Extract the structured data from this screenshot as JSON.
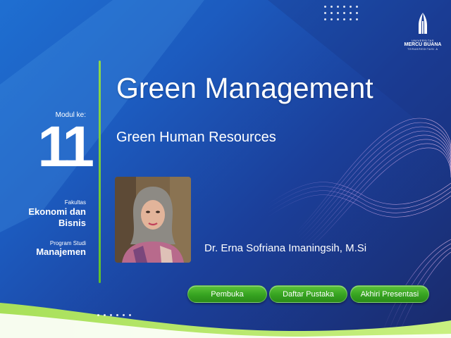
{
  "logo": {
    "small": "UNIVERSITAS",
    "name": "MERCU BUANA",
    "tagline": "TERAKREDITASI A"
  },
  "module": {
    "label": "Modul ke:",
    "number": "11"
  },
  "faculty": {
    "label": "Fakultas",
    "value_line1": "Ekonomi dan",
    "value_line2": "Bisnis"
  },
  "program": {
    "label": "Program Studi",
    "value": "Manajemen"
  },
  "title": "Green Management",
  "subtitle": "Green Human Resources",
  "author": "Dr. Erna Sofriana Imaningsih, M.Si",
  "buttons": {
    "pembuka": "Pembuka",
    "daftar_pustaka": "Daftar Pustaka",
    "akhiri": "Akhiri Presentasi"
  },
  "colors": {
    "accent_green": "#3aab24",
    "bg_blue": "#1c5bbf",
    "bg_dark": "#1a2a6b"
  }
}
